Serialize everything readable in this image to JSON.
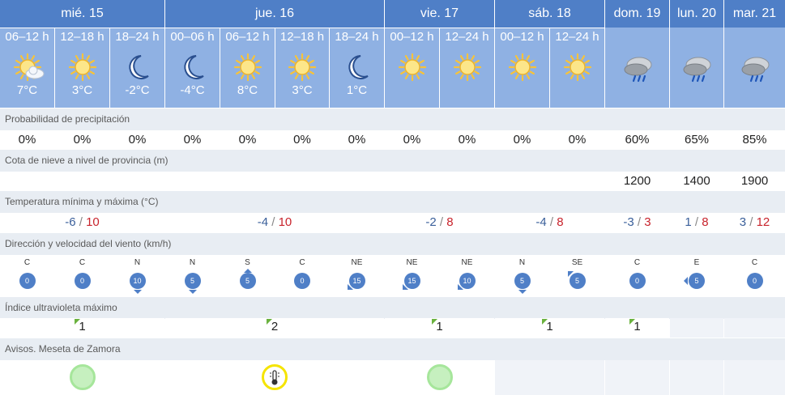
{
  "days": [
    {
      "label": "mié. 15",
      "periods": [
        "06–12 h",
        "12–18 h",
        "18–24 h"
      ],
      "icons": [
        "sun-cloud-icon",
        "sun-icon",
        "moon-icon"
      ],
      "temps": [
        "7°C",
        "3°C",
        "-2°C"
      ],
      "precip": [
        "0%",
        "0%",
        "0%"
      ],
      "snow": [
        "",
        "",
        ""
      ],
      "tmin": "-6",
      "tmax": "10",
      "wind": [
        {
          "dir": "C",
          "speed": "0"
        },
        {
          "dir": "C",
          "speed": "0"
        },
        {
          "dir": "N",
          "speed": "10"
        }
      ],
      "uv": "1",
      "aviso": "green"
    },
    {
      "label": "jue. 16",
      "periods": [
        "00–06 h",
        "06–12 h",
        "12–18 h",
        "18–24 h"
      ],
      "icons": [
        "moon-icon",
        "sun-icon",
        "sun-icon",
        "moon-icon"
      ],
      "temps": [
        "-4°C",
        "8°C",
        "3°C",
        "1°C"
      ],
      "precip": [
        "0%",
        "0%",
        "0%",
        "0%"
      ],
      "snow": [
        "",
        "",
        "",
        ""
      ],
      "tmin": "-4",
      "tmax": "10",
      "wind": [
        {
          "dir": "N",
          "speed": "5"
        },
        {
          "dir": "S",
          "speed": "5"
        },
        {
          "dir": "C",
          "speed": "0"
        },
        {
          "dir": "NE",
          "speed": "15"
        }
      ],
      "uv": "2",
      "aviso": "yellow-thermometer"
    },
    {
      "label": "vie. 17",
      "periods": [
        "00–12 h",
        "12–24 h"
      ],
      "icons": [
        "sun-icon",
        "sun-icon"
      ],
      "temps": [
        "",
        ""
      ],
      "precip": [
        "0%",
        "0%"
      ],
      "snow": [
        "",
        ""
      ],
      "tmin": "-2",
      "tmax": "8",
      "wind": [
        {
          "dir": "NE",
          "speed": "15"
        },
        {
          "dir": "NE",
          "speed": "10"
        }
      ],
      "uv": "1",
      "aviso": "green"
    },
    {
      "label": "sáb. 18",
      "periods": [
        "00–12 h",
        "12–24 h"
      ],
      "icons": [
        "sun-icon",
        "sun-icon"
      ],
      "temps": [
        "",
        ""
      ],
      "precip": [
        "0%",
        "0%"
      ],
      "snow": [
        "",
        ""
      ],
      "tmin": "-4",
      "tmax": "8",
      "wind": [
        {
          "dir": "N",
          "speed": "5"
        },
        {
          "dir": "SE",
          "speed": "5"
        }
      ],
      "uv": "1",
      "aviso": "none"
    },
    {
      "label": "dom. 19",
      "periods": [],
      "icons": [
        "rain-cloud-icon"
      ],
      "temps": [
        ""
      ],
      "precip": [
        "60%"
      ],
      "snow": [
        "1200"
      ],
      "tmin": "-3",
      "tmax": "3",
      "wind": [
        {
          "dir": "C",
          "speed": "0"
        }
      ],
      "uv": "1",
      "aviso": "none"
    },
    {
      "label": "lun. 20",
      "periods": [],
      "icons": [
        "rain-cloud-icon"
      ],
      "temps": [
        ""
      ],
      "precip": [
        "65%"
      ],
      "snow": [
        "1400"
      ],
      "tmin": "1",
      "tmax": "8",
      "wind": [
        {
          "dir": "E",
          "speed": "5"
        }
      ],
      "uv": "",
      "aviso": "none"
    },
    {
      "label": "mar. 21",
      "periods": [],
      "icons": [
        "rain-cloud-icon"
      ],
      "temps": [
        ""
      ],
      "precip": [
        "85%"
      ],
      "snow": [
        "1900"
      ],
      "tmin": "3",
      "tmax": "12",
      "wind": [
        {
          "dir": "C",
          "speed": "0"
        }
      ],
      "uv": "",
      "aviso": "none"
    }
  ],
  "labels": {
    "precip": "Probabilidad de precipitación",
    "snow": "Cota de nieve a nivel de provincia (m)",
    "temp": "Temperatura mínima y máxima (°C)",
    "wind": "Dirección y velocidad del viento (km/h)",
    "uv": "Índice ultravioleta máximo",
    "avisos": "Avisos. Meseta de Zamora"
  },
  "colors": {
    "header": "#4f7fc7",
    "subheader": "#8fb1e3",
    "label_bg": "#e8edf3",
    "min_temp": "#3a5f9a",
    "max_temp": "#c8232c",
    "uv_flag": "#6ab23e",
    "aviso_green": "#c6f0bf",
    "aviso_yellow": "#f5e400"
  }
}
